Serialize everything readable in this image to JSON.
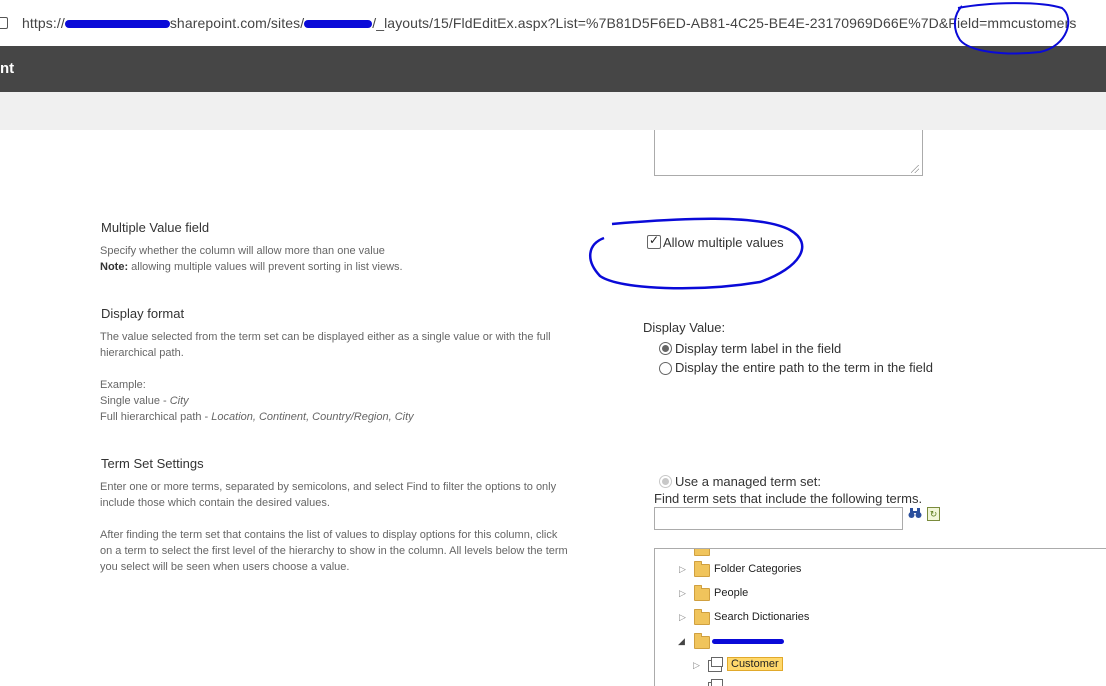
{
  "browser": {
    "url_prefix": "https://",
    "url_middle": "sharepoint.com/sites/",
    "url_suffix": "/_layouts/15/FldEditEx.aspx?List=%7B81D5F6ED-AB81-4C25-BE4E-23170969D66E%7D&Field=mmcustomers"
  },
  "suite": {
    "title": "nt"
  },
  "multiple_value": {
    "title": "Multiple Value field",
    "desc": "Specify whether the column will allow more than one value",
    "note_label": "Note:",
    "note_text": " allowing multiple values will prevent sorting in list views.",
    "checkbox_label": "Allow multiple values",
    "checked": true
  },
  "display_format": {
    "title": "Display format",
    "desc": "The value selected from the term set can be displayed either as a single value or with the full hierarchical path.",
    "example_label": "Example:",
    "single_label": "Single value - ",
    "single_value": "City",
    "full_label": "Full hierarchical path - ",
    "full_value": "Location, Continent, Country/Region, City",
    "display_value_label": "Display Value:",
    "option_label": "Display term label in the field",
    "option_path": "Display the entire path to the term in the field",
    "selected": "label"
  },
  "term_set": {
    "title": "Term Set Settings",
    "desc1": "Enter one or more terms, separated by semicolons, and select Find to filter the options to only include those which contain the desired values.",
    "desc2": "After finding the term set that contains the list of values to display options for this column, click on a term to select the first level of the hierarchy to show in the column. All levels below the term you select will be seen when users choose a value.",
    "use_managed_label": "Use a managed term set:",
    "find_label": "Find term sets that include the following terms.",
    "find_value": "",
    "find_icon": "binoculars-icon",
    "refresh_icon": "refresh-icon",
    "tree": [
      {
        "label": "Folder Categories",
        "type": "group"
      },
      {
        "label": "People",
        "type": "group"
      },
      {
        "label": "Search Dictionaries",
        "type": "group"
      },
      {
        "label": "Customer",
        "type": "termset",
        "selected": true
      }
    ]
  },
  "colors": {
    "suite_bar": "#464646",
    "annotation": "#0a0ad8",
    "selection": "#ffd86b"
  }
}
